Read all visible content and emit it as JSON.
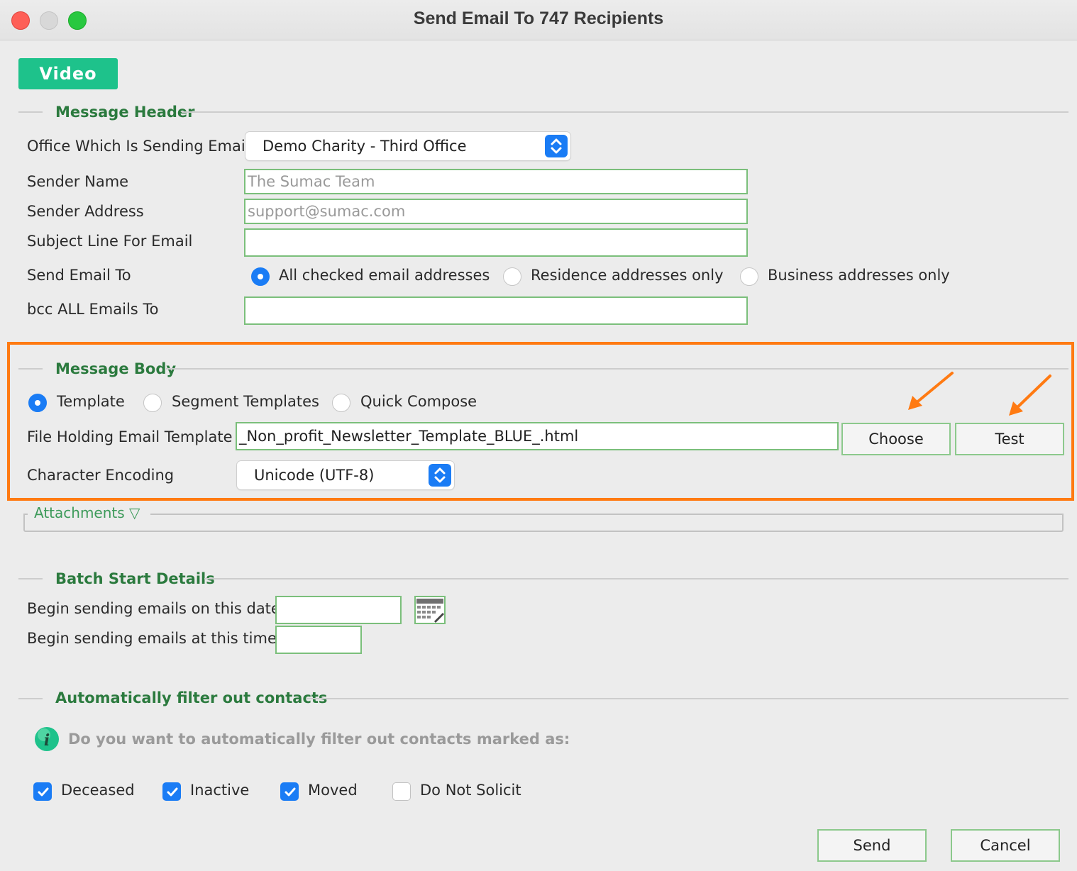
{
  "window": {
    "title": "Send Email To 747 Recipients"
  },
  "video_button": "Video",
  "message_header": {
    "title": "Message Header",
    "office_label": "Office Which Is Sending Email",
    "office_value": "Demo Charity - Third Office",
    "sender_name_label": "Sender Name",
    "sender_name_placeholder": "The Sumac Team",
    "sender_address_label": "Sender Address",
    "sender_address_placeholder": "support@sumac.com",
    "subject_label": "Subject Line For Email",
    "subject_value": "",
    "send_to_label": "Send Email To",
    "send_to_options": [
      "All checked email addresses",
      "Residence addresses only",
      "Business addresses only"
    ],
    "send_to_selected": "All checked email addresses",
    "bcc_label": "bcc ALL Emails To",
    "bcc_value": ""
  },
  "message_body": {
    "title": "Message Body",
    "options": [
      "Template",
      "Segment Templates",
      "Quick Compose"
    ],
    "selected": "Template",
    "file_label": "File Holding Email Template",
    "file_value": "_Non_profit_Newsletter_Template_BLUE_.html",
    "choose_button": "Choose",
    "test_button": "Test",
    "encoding_label": "Character Encoding",
    "encoding_value": "Unicode (UTF-8)",
    "highlight_color": "#ff7a12"
  },
  "attachments": {
    "title": "Attachments ▽"
  },
  "batch": {
    "title": "Batch Start Details",
    "date_label": "Begin sending emails on this date",
    "date_value": "",
    "time_label": "Begin sending emails at this time",
    "time_value": ""
  },
  "filter": {
    "title": "Automatically filter out contacts",
    "question": "Do you want to automatically filter out contacts marked as:",
    "items": [
      {
        "label": "Deceased",
        "checked": true
      },
      {
        "label": "Inactive",
        "checked": true
      },
      {
        "label": "Moved",
        "checked": true
      },
      {
        "label": "Do Not Solicit",
        "checked": false
      }
    ]
  },
  "footer": {
    "send_button": "Send",
    "cancel_button": "Cancel"
  },
  "colors": {
    "accent": "#1a7cf5",
    "section_green": "#2b7a3e",
    "video_green": "#1ec28b",
    "field_border": "#7bbf7b"
  }
}
